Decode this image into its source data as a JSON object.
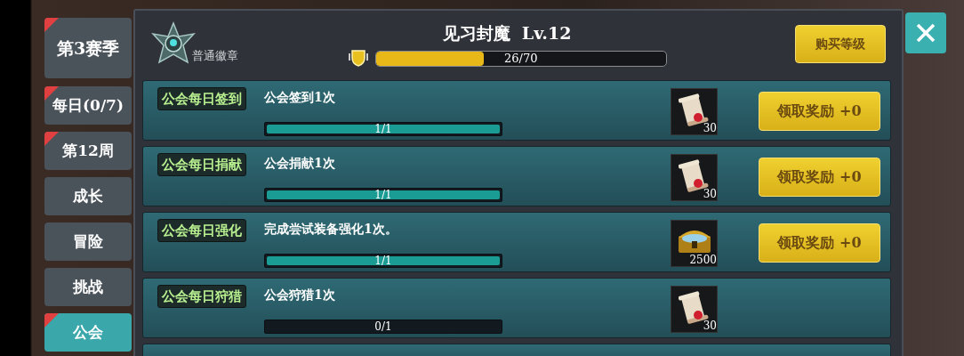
{
  "sidebar": {
    "items": [
      {
        "label": "第3赛季",
        "selected": false,
        "badge": true
      },
      {
        "label": "每日(0/7)",
        "selected": false,
        "badge": true
      },
      {
        "label": "第12周",
        "selected": false,
        "badge": true
      },
      {
        "label": "成长",
        "selected": false,
        "badge": false
      },
      {
        "label": "冒险",
        "selected": false,
        "badge": false
      },
      {
        "label": "挑战",
        "selected": false,
        "badge": false
      },
      {
        "label": "公会",
        "selected": true,
        "badge": true
      }
    ]
  },
  "header": {
    "badge_label": "普通徽章",
    "title": "见习封魔  Lv.12",
    "progress": {
      "text": "26/70",
      "level": 0.371
    },
    "buy_button": "购买等级"
  },
  "tasks": [
    {
      "tag": "公会每日签到",
      "description": "公会签到1次",
      "progress": {
        "text": "1/1",
        "level": 1
      },
      "reward": {
        "kind": "scroll",
        "count": "30"
      },
      "claim_button": "领取奖励 +0"
    },
    {
      "tag": "公会每日捐献",
      "description": "公会捐献1次",
      "progress": {
        "text": "1/1",
        "level": 1
      },
      "reward": {
        "kind": "scroll",
        "count": "30"
      },
      "claim_button": "领取奖励 +0"
    },
    {
      "tag": "公会每日强化",
      "description": "完成尝试装备强化1次。",
      "progress": {
        "text": "1/1",
        "level": 1
      },
      "reward": {
        "kind": "chest",
        "count": "2500"
      },
      "claim_button": "领取奖励 +0"
    },
    {
      "tag": "公会每日狩猎",
      "description": "公会狩猎1次",
      "progress": {
        "text": "0/1",
        "level": 0
      },
      "reward": {
        "kind": "scroll",
        "count": "30"
      }
    }
  ]
}
